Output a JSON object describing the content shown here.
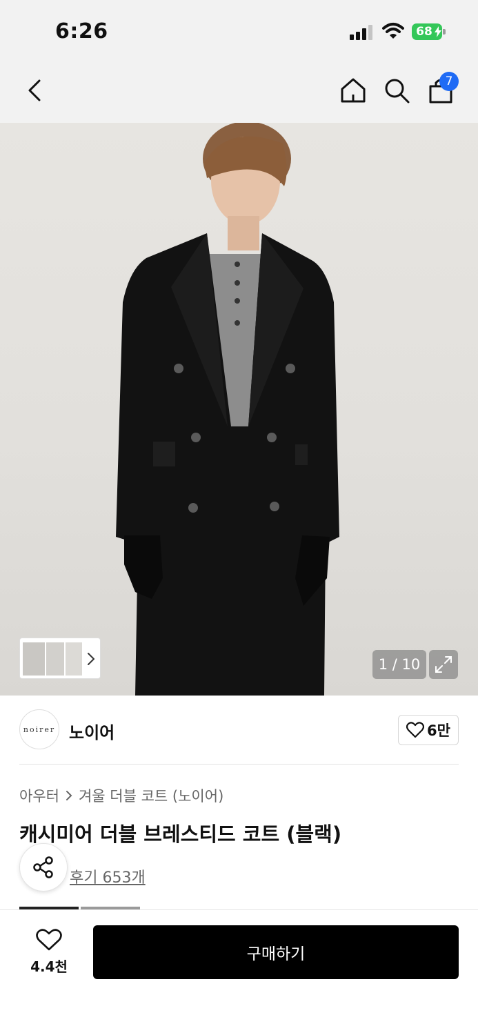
{
  "status_bar": {
    "time": "6:26",
    "battery": "68"
  },
  "nav": {
    "cart_count": "7",
    "icons": [
      "chevron-left-icon",
      "home-icon",
      "search-icon",
      "shopping-bag-icon"
    ]
  },
  "gallery": {
    "counter": "1 / 10",
    "expand_icon": "expand-icon"
  },
  "brand": {
    "logo_text": "noirer",
    "name": "노이어",
    "likes": "6만"
  },
  "product": {
    "breadcrumb": [
      "아우터",
      "겨울 더블 코트 (노이어)"
    ],
    "title": "캐시미어 더블 브레스티드 코트 (블랙)",
    "reviews": "후기 653개"
  },
  "bottom_bar": {
    "wish_count": "4.4천",
    "buy_label": "구매하기"
  },
  "colors": {
    "accent": "#1f6bf5",
    "battery": "#34c759",
    "buy_button": "#000000"
  }
}
